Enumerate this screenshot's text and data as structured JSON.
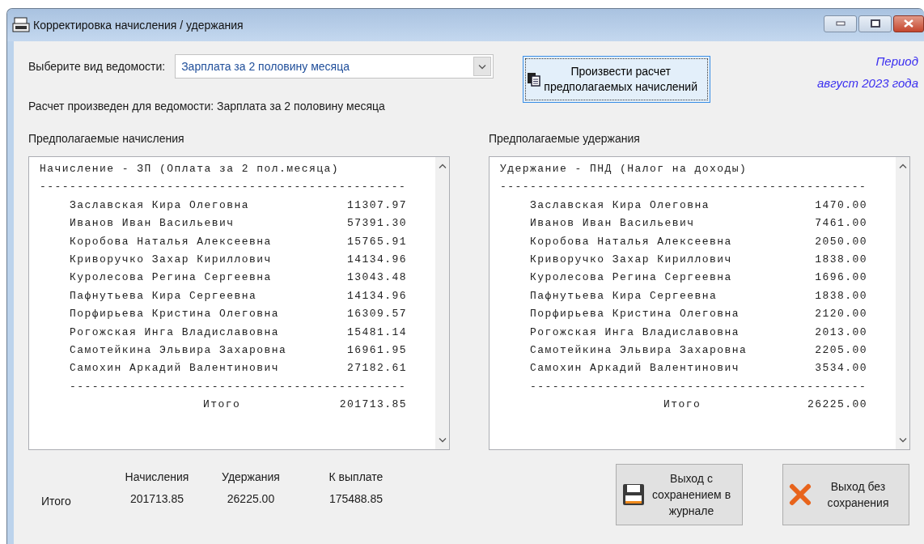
{
  "window": {
    "title": "Корректировка начисления / удержания"
  },
  "statement": {
    "label": "Выберите вид ведомости:",
    "value": "Зарплата за 2 половину месяца"
  },
  "calc_button": {
    "label": "Произвести расчет предполагаемых начислений"
  },
  "period": {
    "label": "Период",
    "value": "август 2023 года"
  },
  "status_text": "Расчет произведен для ведомости: Зарплата за 2 половину месяца",
  "panels": [
    {
      "title": "Предполагаемые начисления",
      "header": "Начисление - ЗП (Оплата за 2 пол.месяца)",
      "separator": "-------------------------------------------------",
      "rows": [
        {
          "name": "Заславская Кира Олеговна",
          "amount": "11307.97"
        },
        {
          "name": "Иванов Иван Васильевич",
          "amount": "57391.30"
        },
        {
          "name": "Коробова Наталья Алексеевна",
          "amount": "15765.91"
        },
        {
          "name": "Криворучко Захар Кириллович",
          "amount": "14134.96"
        },
        {
          "name": "Куролесова Регина Сергеевна",
          "amount": "13043.48"
        },
        {
          "name": "Пафнутьева Кира Сергеевна",
          "amount": "14134.96"
        },
        {
          "name": "Порфирьева Кристина Олеговна",
          "amount": "16309.57"
        },
        {
          "name": "Рогожская Инга Владиславовна",
          "amount": "15481.14"
        },
        {
          "name": "Самотейкина Эльвира Захаровна",
          "amount": "16961.95"
        },
        {
          "name": "Самохин Аркадий Валентинович",
          "amount": "27182.61"
        }
      ],
      "total_separator": "---------------------------------------------",
      "total_label": "Итого",
      "total": "201713.85"
    },
    {
      "title": "Предполагаемые удержания",
      "header": "Удержание - ПНД (Налог на доходы)",
      "separator": "-------------------------------------------------",
      "rows": [
        {
          "name": "Заславская Кира Олеговна",
          "amount": "1470.00"
        },
        {
          "name": "Иванов Иван Васильевич",
          "amount": "7461.00"
        },
        {
          "name": "Коробова Наталья Алексеевна",
          "amount": "2050.00"
        },
        {
          "name": "Криворучко Захар Кириллович",
          "amount": "1838.00"
        },
        {
          "name": "Куролесова Регина Сергеевна",
          "amount": "1696.00"
        },
        {
          "name": "Пафнутьева Кира Сергеевна",
          "amount": "1838.00"
        },
        {
          "name": "Порфирьева Кристина Олеговна",
          "amount": "2120.00"
        },
        {
          "name": "Рогожская Инга Владиславовна",
          "amount": "2013.00"
        },
        {
          "name": "Самотейкина Эльвира Захаровна",
          "amount": "2205.00"
        },
        {
          "name": "Самохин Аркадий Валентинович",
          "amount": "3534.00"
        }
      ],
      "total_separator": "---------------------------------------------",
      "total_label": "Итого",
      "total": "26225.00"
    }
  ],
  "totals": {
    "row_label": "Итого",
    "columns": [
      {
        "header": "Начисления",
        "value": "201713.85"
      },
      {
        "header": "Удержания",
        "value": "26225.00"
      },
      {
        "header": "К выплате",
        "value": "175488.85"
      }
    ]
  },
  "buttons": [
    {
      "kind": "save",
      "label": "Выход с сохранением в журнале"
    },
    {
      "kind": "discard",
      "label": "Выход без сохранения"
    }
  ]
}
